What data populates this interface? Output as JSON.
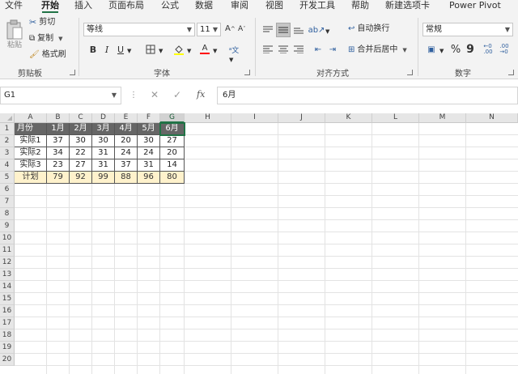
{
  "menu": {
    "tabs": [
      "文件",
      "开始",
      "插入",
      "页面布局",
      "公式",
      "数据",
      "审阅",
      "视图",
      "开发工具",
      "帮助",
      "新建选项卡",
      "Power Pivot"
    ],
    "active_tab": "开始"
  },
  "ribbon": {
    "clipboard": {
      "paste": "粘贴",
      "cut": "剪切",
      "copy": "复制",
      "format_painter": "格式刷",
      "group_label": "剪贴板"
    },
    "font": {
      "font_name": "等线",
      "font_size": "11",
      "group_label": "字体",
      "bold": "B",
      "italic": "I",
      "underline": "U"
    },
    "alignment": {
      "wrap_text": "自动换行",
      "merge_center": "合并后居中",
      "group_label": "对齐方式"
    },
    "number": {
      "format": "常规",
      "group_label": "数字",
      "percent": "%",
      "comma": "9"
    }
  },
  "formula_bar": {
    "name_box": "G1",
    "fx": "fx",
    "value": "6月"
  },
  "grid": {
    "columns": [
      "A",
      "B",
      "C",
      "D",
      "E",
      "F",
      "G",
      "H",
      "I",
      "J",
      "K",
      "L",
      "M",
      "N"
    ],
    "rows": [
      "1",
      "2",
      "3",
      "4",
      "5",
      "6",
      "7",
      "8",
      "9",
      "10",
      "11",
      "12",
      "13",
      "14",
      "15",
      "16",
      "17",
      "18",
      "19",
      "20"
    ],
    "table": {
      "header": [
        "月份",
        "1月",
        "2月",
        "3月",
        "4月",
        "5月",
        "6月"
      ],
      "rows": [
        [
          "实际1",
          "37",
          "30",
          "30",
          "20",
          "30",
          "27"
        ],
        [
          "实际2",
          "34",
          "22",
          "31",
          "24",
          "24",
          "20"
        ],
        [
          "实际3",
          "23",
          "27",
          "31",
          "37",
          "31",
          "14"
        ]
      ],
      "plan": [
        "计划",
        "79",
        "92",
        "99",
        "88",
        "96",
        "80"
      ]
    }
  },
  "colors": {
    "accent": "#217346",
    "header_fill": "#666666",
    "plan_fill": "#fff2cc"
  }
}
